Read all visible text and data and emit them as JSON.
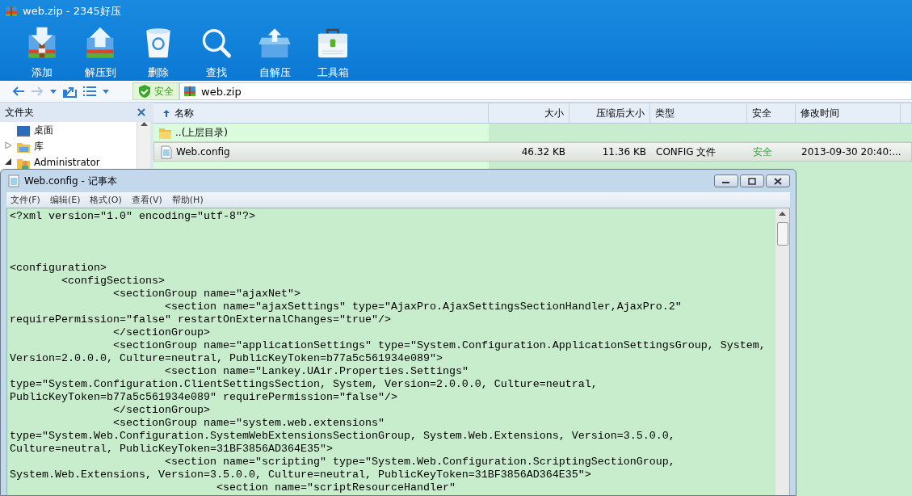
{
  "window": {
    "title": "web.zip - 2345好压"
  },
  "toolbar": [
    {
      "label": "添加",
      "kind": "add"
    },
    {
      "label": "解压到",
      "kind": "extract"
    },
    {
      "label": "删除",
      "kind": "delete"
    },
    {
      "label": "查找",
      "kind": "find"
    },
    {
      "label": "自解压",
      "kind": "sfx"
    },
    {
      "label": "工具箱",
      "kind": "toolbox"
    }
  ],
  "address_bar": {
    "security": "安全",
    "path": "web.zip"
  },
  "folder_pane": {
    "title": "文件夹",
    "items": [
      {
        "label": "桌面",
        "kind": "desktop"
      },
      {
        "label": "库",
        "kind": "library",
        "expanded": false
      },
      {
        "label": "Administrator",
        "kind": "user",
        "expanded": true
      }
    ]
  },
  "file_list": {
    "columns": [
      "名称",
      "大小",
      "压缩后大小",
      "类型",
      "安全",
      "修改时间"
    ],
    "rows": [
      {
        "kind": "parent",
        "name": "..(上层目录)",
        "size": "",
        "packed": "",
        "type": "",
        "safety": "",
        "modified": "",
        "selected": false
      },
      {
        "kind": "file",
        "name": "Web.config",
        "size": "46.32 KB",
        "packed": "11.36 KB",
        "type": "CONFIG 文件",
        "safety": "安全",
        "modified": "2013-09-30 20:40:...",
        "selected": true
      }
    ]
  },
  "notepad": {
    "title": "Web.config - 记事本",
    "menu": [
      "文件(F)",
      "编辑(E)",
      "格式(O)",
      "查看(V)",
      "帮助(H)"
    ],
    "lines": [
      "<?xml version=\"1.0\" encoding=\"utf-8\"?>\n\n\n\n<configuration>",
      "\t<configSections>",
      "\t\t<sectionGroup name=\"ajaxNet\">",
      "\t\t\t<section name=\"ajaxSettings\" type=\"AjaxPro.AjaxSettingsSectionHandler,AjaxPro.2\"",
      "requirePermission=\"false\" restartOnExternalChanges=\"true\"/>",
      "\t\t</sectionGroup>",
      "\t\t<sectionGroup name=\"applicationSettings\" type=\"System.Configuration.ApplicationSettingsGroup, System,",
      "Version=2.0.0.0, Culture=neutral, PublicKeyToken=b77a5c561934e089\">",
      "\t\t\t<section name=\"Lankey.UAir.Properties.Settings\"",
      "type=\"System.Configuration.ClientSettingsSection, System, Version=2.0.0.0, Culture=neutral,",
      "PublicKeyToken=b77a5c561934e089\" requirePermission=\"false\"/>",
      "\t\t</sectionGroup>",
      "\t\t<sectionGroup name=\"system.web.extensions\"",
      "type=\"System.Web.Configuration.SystemWebExtensionsSectionGroup, System.Web.Extensions, Version=3.5.0.0,",
      "Culture=neutral, PublicKeyToken=31BF3856AD364E35\">",
      "\t\t\t<section name=\"scripting\" type=\"System.Web.Configuration.ScriptingSectionGroup,",
      "System.Web.Extensions, Version=3.5.0.0, Culture=neutral, PublicKeyToken=31BF3856AD364E35\">",
      "\t\t\t\t<section name=\"scriptResourceHandler\""
    ]
  }
}
